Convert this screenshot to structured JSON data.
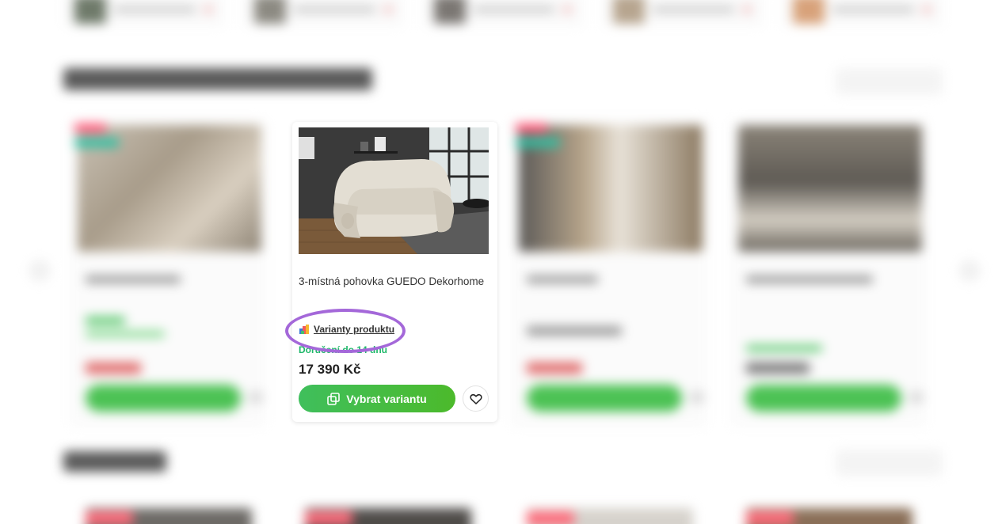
{
  "product": {
    "name": "3-místná pohovka GUEDO Dekorhome",
    "variants_label": "Varianty produktu",
    "delivery": "Doručení do 14 dnů",
    "price": "17 390 Kč",
    "choose_variant_label": "Vybrat variantu"
  },
  "icons": {
    "variants": "palette-icon",
    "choose_variant": "copy-icon",
    "wishlist": "heart-icon",
    "prev": "chevron-left-icon",
    "next": "chevron-right-icon"
  },
  "colors": {
    "accent_green": "#4cba2b",
    "delivery_green": "#1fb86a",
    "highlight_purple": "#a468d9"
  }
}
